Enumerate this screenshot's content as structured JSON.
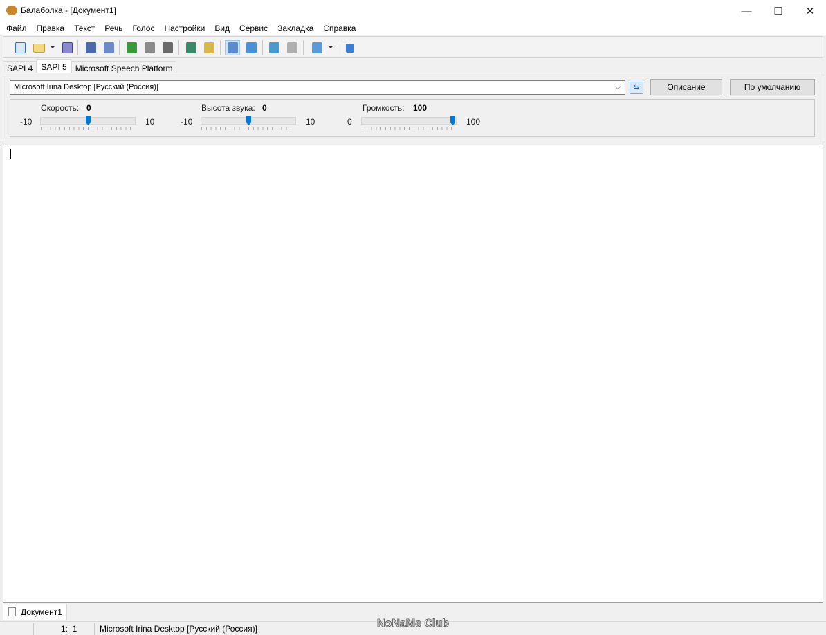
{
  "window": {
    "title": "Балаболка - [Документ1]",
    "minimize": "—",
    "maximize": "☐",
    "close": "✕"
  },
  "menu": [
    "Файл",
    "Правка",
    "Текст",
    "Речь",
    "Голос",
    "Настройки",
    "Вид",
    "Сервис",
    "Закладка",
    "Справка"
  ],
  "toolbar": {
    "icons": [
      "new-document-icon",
      "open-folder-icon",
      "save-icon",
      "export-audio-icon",
      "batch-convert-icon",
      "play-icon",
      "pause-icon",
      "stop-icon",
      "read-clipboard-icon",
      "read-file-icon",
      "edit-text-icon",
      "spelling-icon",
      "add-bookmark-icon",
      "remove-bookmark-icon",
      "dictionary-icon",
      "help-icon"
    ]
  },
  "engine_tabs": [
    "SAPI 4",
    "SAPI 5",
    "Microsoft Speech Platform"
  ],
  "voice": {
    "selected": "Microsoft Irina Desktop [Русский (Россия)]",
    "describe_button": "Описание",
    "default_button": "По умолчанию"
  },
  "sliders": [
    {
      "label": "Скорость:",
      "value": "0",
      "min": "-10",
      "max": "10",
      "fraction": 0.5
    },
    {
      "label": "Высота звука:",
      "value": "0",
      "min": "-10",
      "max": "10",
      "fraction": 0.5
    },
    {
      "label": "Громкость:",
      "value": "100",
      "min": "0",
      "max": "100",
      "fraction": 1.0
    }
  ],
  "document_tab": "Документ1",
  "status": {
    "position": "1:  1",
    "voice": "Microsoft Irina Desktop [Русский (Россия)]"
  },
  "watermark": "NoNaMe Club"
}
